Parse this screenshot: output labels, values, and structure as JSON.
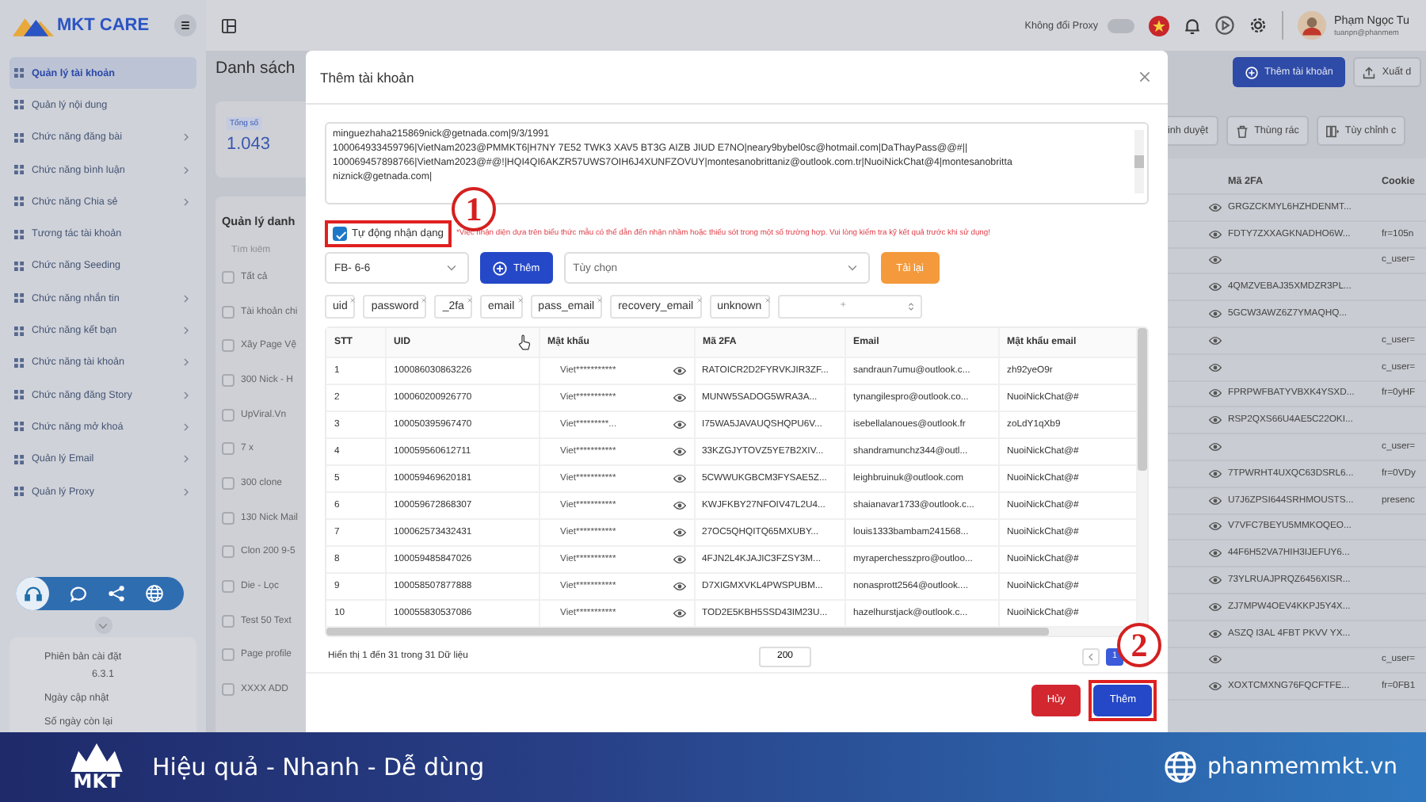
{
  "sidebar": {
    "logo": "MKT CARE",
    "items": [
      {
        "label": "Quản lý tài khoản",
        "selected": true,
        "has_submenu": false
      },
      {
        "label": "Quản lý nội dung",
        "selected": false,
        "has_submenu": false
      },
      {
        "label": "Chức năng đăng bài",
        "selected": false,
        "has_submenu": true
      },
      {
        "label": "Chức năng bình luận",
        "selected": false,
        "has_submenu": true
      },
      {
        "label": "Chức năng Chia sẻ",
        "selected": false,
        "has_submenu": true
      },
      {
        "label": "Tương tác tài khoản",
        "selected": false,
        "has_submenu": false
      },
      {
        "label": "Chức năng Seeding",
        "selected": false,
        "has_submenu": false
      },
      {
        "label": "Chức năng nhắn tin",
        "selected": false,
        "has_submenu": true
      },
      {
        "label": "Chức năng kết bạn",
        "selected": false,
        "has_submenu": true
      },
      {
        "label": "Chức năng tài khoản",
        "selected": false,
        "has_submenu": true
      },
      {
        "label": "Chức năng đăng Story",
        "selected": false,
        "has_submenu": true
      },
      {
        "label": "Chức năng mở khoá",
        "selected": false,
        "has_submenu": true
      },
      {
        "label": "Quản lý Email",
        "selected": false,
        "has_submenu": true
      },
      {
        "label": "Quản lý Proxy",
        "selected": false,
        "has_submenu": true
      }
    ],
    "version_card": {
      "version_label": "Phiên bản cài đặt",
      "version": "6.3.1",
      "updated_label": "Ngày cập nhật",
      "days_left_label": "Số ngày còn lại"
    }
  },
  "topbar": {
    "proxy_label": "Không đổi Proxy",
    "proxy_on": false,
    "user_name": "Phạm Ngọc Tu",
    "user_email": "tuanpn@phanmem"
  },
  "page": {
    "title": "Danh sách",
    "total_label": "Tổng số",
    "total": "1.043",
    "groups_title": "Quản lý danh",
    "search_placeholder": "Tìm kiếm",
    "groups": [
      {
        "label": "Tất cả",
        "checked": false
      },
      {
        "label": "Tài khoản chi",
        "checked": false
      },
      {
        "label": "Xây Page Vệ",
        "checked": false
      },
      {
        "label": "300 Nick - H",
        "checked": false
      },
      {
        "label": "UpViral.Vn",
        "checked": false
      },
      {
        "label": "7 x",
        "checked": false
      },
      {
        "label": "300 clone",
        "checked": false
      },
      {
        "label": "130 Nick Mail",
        "checked": false
      },
      {
        "label": "Clon 200 9-5",
        "checked": false
      },
      {
        "label": "Die - Lọc",
        "checked": false
      },
      {
        "label": "Test 50 Text",
        "checked": false
      },
      {
        "label": "Page profile",
        "checked": false
      },
      {
        "label": "XXXX ADD",
        "checked": false
      }
    ],
    "add_button": "Thêm tài khoản",
    "export_button": "Xuất d",
    "toolbar": [
      "inh duyệt",
      "Thùng rác",
      "Tùy chỉnh c"
    ],
    "columns": [
      "Mã 2FA",
      "Cookie"
    ],
    "rows": [
      {
        "code": "GRGZCKMYL6HZHDENMT..."
      },
      {
        "code": "FDTY7ZXXAGKNADHO6W...",
        "cookie": "fr=105n"
      },
      {
        "cookie": "c_user="
      },
      {
        "code": "4QMZVEBAJ35XMDZR3PL..."
      },
      {
        "code": "5GCW3AWZ6Z7YMAQHQ..."
      },
      {
        "cookie": "c_user="
      },
      {
        "cookie": "c_user="
      },
      {
        "code": "FPRPWFBATYVBXK4YSXD...",
        "cookie": "fr=0yHF"
      },
      {
        "code": "RSP2QXS66U4AE5C22OKI..."
      },
      {
        "cookie": "c_user="
      },
      {
        "code": "7TPWRHT4UXQC63DSRL6...",
        "cookie": "fr=0VDy"
      },
      {
        "code": "U7J6ZPSI644SRHMOUSTS...",
        "cookie": "presenc"
      },
      {
        "code": "V7VFC7BEYU5MMKOQEO..."
      },
      {
        "code": "44F6H52VA7HIH3IJEFUY6..."
      },
      {
        "code": "73YLRUAJPRQZ6456XISR..."
      },
      {
        "code": "ZJ7MPW4OEV4KKPJ5Y4X..."
      },
      {
        "code": "ASZQ I3AL 4FBT PKVV YX..."
      },
      {
        "cookie": "c_user="
      },
      {
        "code": "XOXTCMXNG76FQCFTFE...",
        "cookie": "fr=0FB1"
      }
    ]
  },
  "modal": {
    "title": "Thêm tài khoản",
    "input_lines": [
      "minguezhaha215869nick@getnada.com|9/3/1991",
      "100064933459796|VietNam2023@PMMKT6|H7NY 7E52 TWK3 XAV5 BT3G AIZB JIUD E7NO|neary9bybel0sc@hotmail.com|DaThayPass@@#||",
      "100069457898766|VietNam2023@#@!|HQI4QI6AKZR57UWS7OIH6J4XUNFZOVUY|montesanobrittaniz@outlook.com.tr|NuoiNickChat@4|montesanobritta",
      "niznick@getnada.com|"
    ],
    "auto_detect": {
      "label": "Tự động nhận dạng",
      "checked": true,
      "annotated": true
    },
    "warning": "*Việc nhận diện dựa trên biểu thức mẫu có thể dẫn đến nhận nhầm hoặc thiếu sót trong một số trường hợp. Vui lòng kiểm tra kỹ kết quả trước khi sử dụng!",
    "format_select": "FB- 6-6",
    "add_button": "Thêm",
    "option_placeholder": "Tùy chọn",
    "reload_button": "Tải lại",
    "fields": [
      "uid",
      "password",
      "_2fa",
      "email",
      "pass_email",
      "recovery_email",
      "unknown"
    ],
    "field_add_placeholder": "+",
    "table": {
      "columns": [
        "STT",
        "UID",
        "Mật khẩu",
        "Mã 2FA",
        "Email",
        "Mật khẩu email"
      ],
      "rows": [
        [
          "1",
          "100086030863226",
          "Viet***********",
          "RATOICR2D2FYRVKJIR3ZF...",
          "sandraun7umu@outlook.c...",
          "zh92yeO9r"
        ],
        [
          "2",
          "100060200926770",
          "Viet***********",
          "MUNW5SADOG5WRA3A...",
          "tynangilespro@outlook.co...",
          "NuoiNickChat@#"
        ],
        [
          "3",
          "100050395967470",
          "Viet*********...",
          "I75WA5JAVAUQSHQPU6V...",
          "isebellalanoues@outlook.fr",
          "zoLdY1qXb9"
        ],
        [
          "4",
          "100059560612711",
          "Viet***********",
          "33KZGJYTOVZ5YE7B2XIV...",
          "shandramunchz344@outl...",
          "NuoiNickChat@#"
        ],
        [
          "5",
          "100059469620181",
          "Viet***********",
          "5CWWUKGBCM3FYSAE5Z...",
          "leighbruinuk@outlook.com",
          "NuoiNickChat@#"
        ],
        [
          "6",
          "100059672868307",
          "Viet***********",
          "KWJFKBY27NFOIV47L2U4...",
          "shaianavar1733@outlook.c...",
          "NuoiNickChat@#"
        ],
        [
          "7",
          "100062573432431",
          "Viet***********",
          "27OC5QHQITQ65MXUBY...",
          "louis1333bambam241568...",
          "NuoiNickChat@#"
        ],
        [
          "8",
          "100059485847026",
          "Viet***********",
          "4FJN2L4KJAJIC3FZSY3M...",
          "myraperchesszpro@outloo...",
          "NuoiNickChat@#"
        ],
        [
          "9",
          "100058507877888",
          "Viet***********",
          "D7XIGMXVKL4PWSPUBM...",
          "nonasprott2564@outlook....",
          "NuoiNickChat@#"
        ],
        [
          "10",
          "100055830537086",
          "Viet***********",
          "TOD2E5KBH5SSD43IM23U...",
          "hazelhurstjack@outlook.c...",
          "NuoiNickChat@#"
        ]
      ]
    },
    "summary": "Hiển thị 1 đến 31 trong 31 Dữ liệu",
    "per_page": "200",
    "pages": [
      {
        "label": "1",
        "selected": true
      }
    ],
    "cancel_button": "Hủy",
    "confirm_button": "Thêm",
    "confirm_annotated": true
  },
  "annotations": [
    {
      "mark": "1"
    },
    {
      "mark": "2"
    }
  ],
  "banner": {
    "logo_text": "MKT",
    "slogan": "Hiệu quả - Nhanh - Dễ dùng",
    "website": "phanmemmkt.vn"
  }
}
